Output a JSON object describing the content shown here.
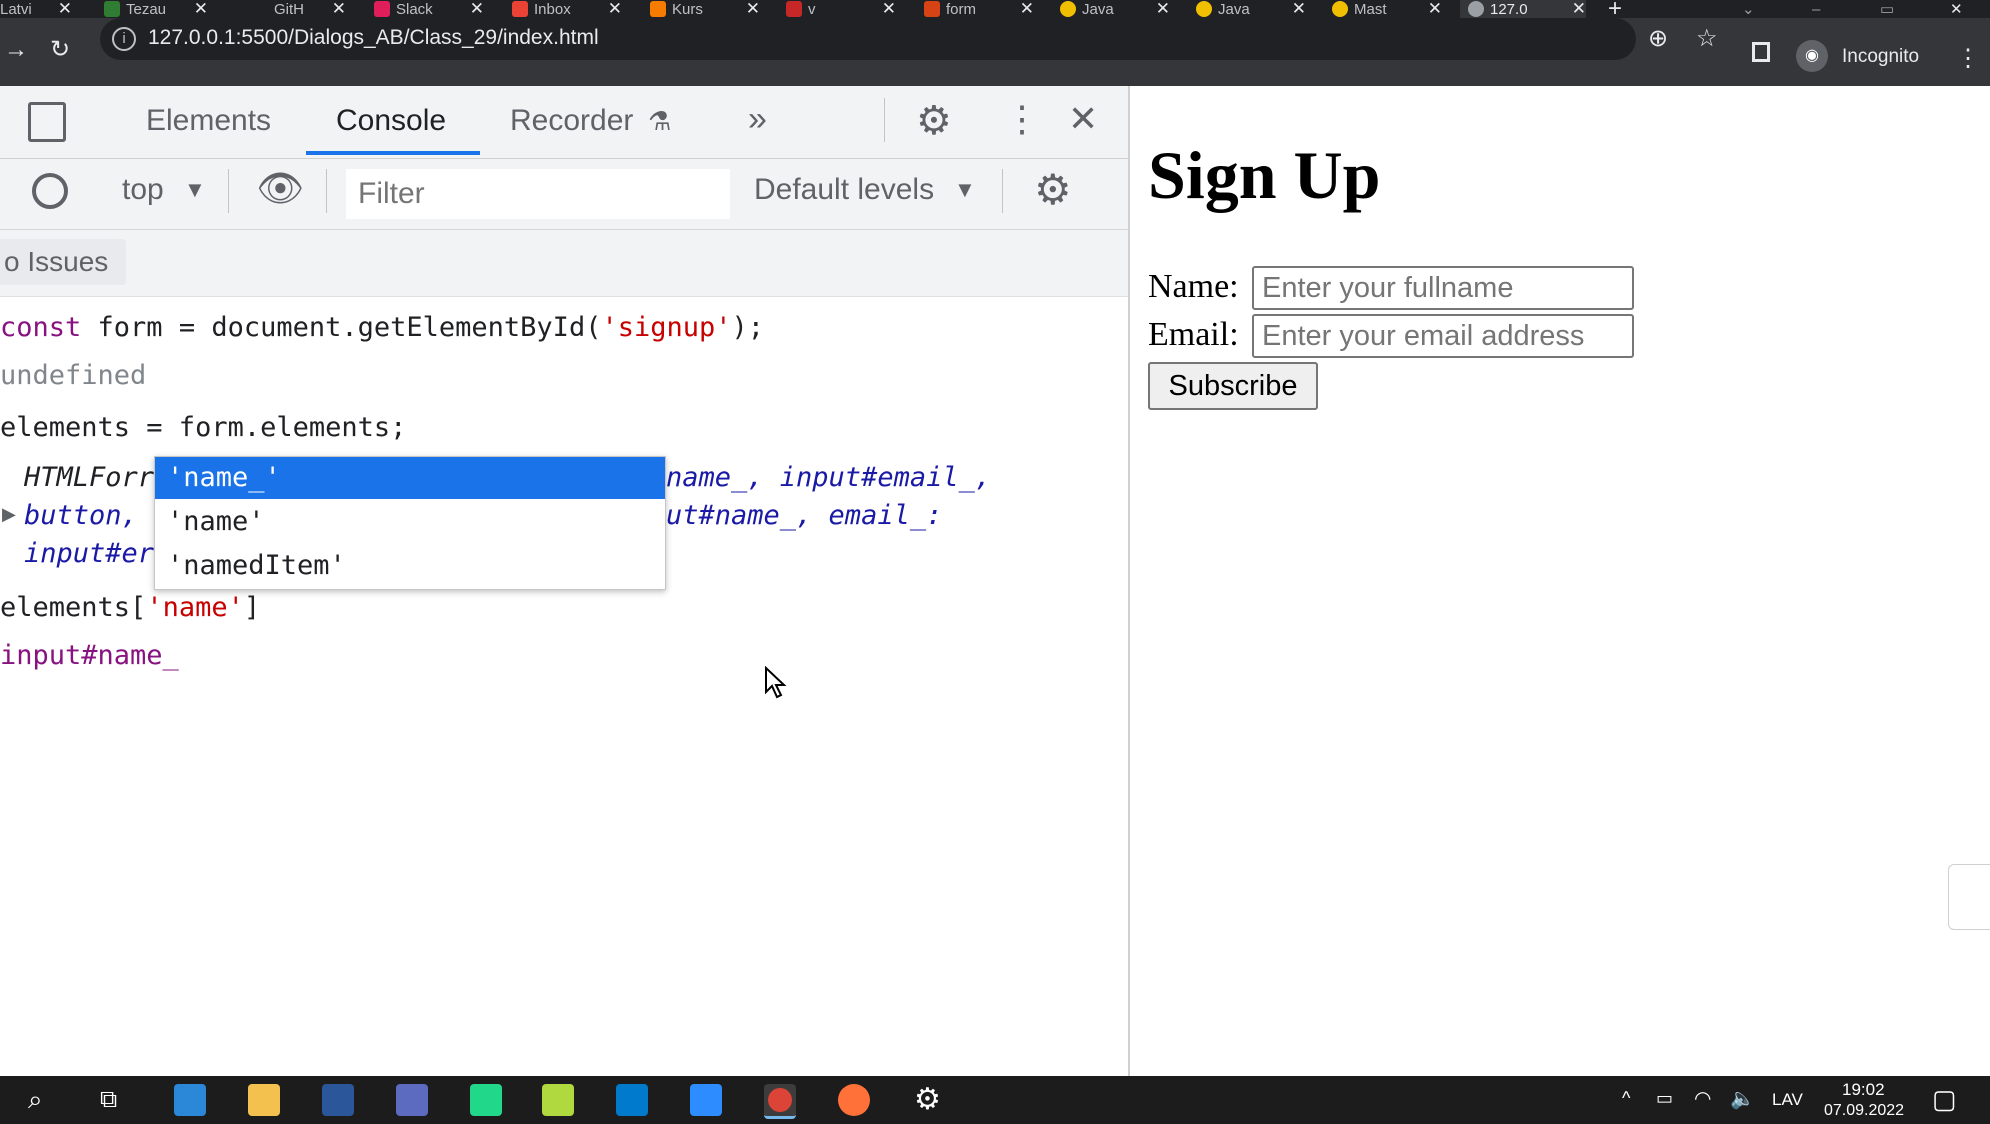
{
  "browser": {
    "tabs": [
      {
        "label": "Latvi"
      },
      {
        "label": "Tezau"
      },
      {
        "label": "GitH"
      },
      {
        "label": "Slack"
      },
      {
        "label": "Inbox"
      },
      {
        "label": "Kurs"
      },
      {
        "label": "v"
      },
      {
        "label": "form"
      },
      {
        "label": "Java"
      },
      {
        "label": "Java"
      },
      {
        "label": "Mast"
      },
      {
        "label": "127.0"
      }
    ],
    "url": "127.0.0.1:5500/Dialogs_AB/Class_29/index.html",
    "incognito_label": "Incognito"
  },
  "devtools": {
    "tabs": {
      "elements": "Elements",
      "console": "Console",
      "recorder": "Recorder",
      "more": "»"
    },
    "context": "top",
    "filter_placeholder": "Filter",
    "levels": "Default levels",
    "issues": "o Issues",
    "console_lines": {
      "l1_kw": "const",
      "l1_a": " form = document.getElementById(",
      "l1_str": "'signup'",
      "l1_b": ");",
      "l2": "undefined",
      "l3": "elements = form.elements;",
      "l4a": "HTMLForr",
      "l4b": "name_, input#email_,",
      "l5a": "button,",
      "l5b": "ut#name_, email_:",
      "l6a": "input#er",
      "l7a": "elements[",
      "l7_str": "'name'",
      "l7b": "]",
      "l8": "input#name_"
    },
    "autocomplete": [
      "'name_'",
      "'name'",
      "'namedItem'"
    ]
  },
  "page": {
    "title": "Sign Up",
    "name_label": "Name:",
    "name_placeholder": "Enter your fullname",
    "email_label": "Email:",
    "email_placeholder": "Enter your email address",
    "subscribe": "Subscribe"
  },
  "taskbar": {
    "lang": "LAV",
    "time": "19:02",
    "date": "07.09.2022"
  }
}
